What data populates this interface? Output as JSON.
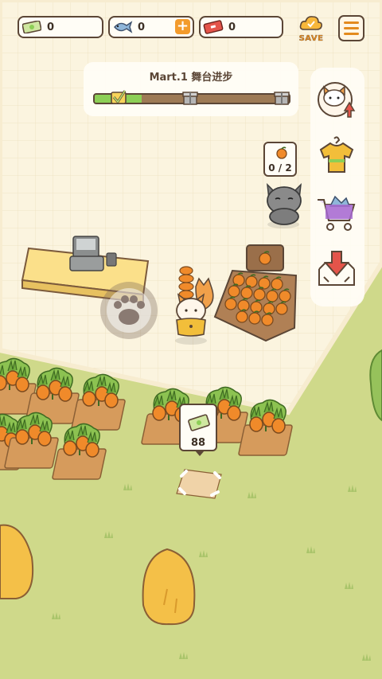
{
  "hud": {
    "cash": {
      "value": "0",
      "icon": "cash-note-icon"
    },
    "fish": {
      "value": "0",
      "icon": "fish-icon",
      "add_label": "+"
    },
    "ticket": {
      "value": "0",
      "icon": "ticket-icon"
    },
    "save_label": "SAVE",
    "menu_icon": "hamburger-menu-icon"
  },
  "stage_progress": {
    "title": "Mart.1 舞台进步",
    "fraction": 0.24,
    "milestones": [
      "check-reward-icon",
      "gift-box-icon",
      "gift-box-icon"
    ]
  },
  "side_actions": [
    {
      "name": "upgrade-staff-button",
      "icon": "cat-upgrade-icon"
    },
    {
      "name": "outfit-button",
      "icon": "shirt-icon"
    },
    {
      "name": "shop-cart-button",
      "icon": "shopping-cart-icon"
    },
    {
      "name": "stock-drop-button",
      "icon": "box-download-icon"
    }
  ],
  "customer_request": {
    "item_icon": "orange-icon",
    "text": "0 / 2"
  },
  "build_spot": {
    "price": "88",
    "icon": "cash-note-icon"
  },
  "colors": {
    "floor": "#fbf4df",
    "grass": "#cfd98a",
    "outline": "#5b4636",
    "accent_orange": "#f39b2c",
    "progress_green": "#8ccf56"
  }
}
